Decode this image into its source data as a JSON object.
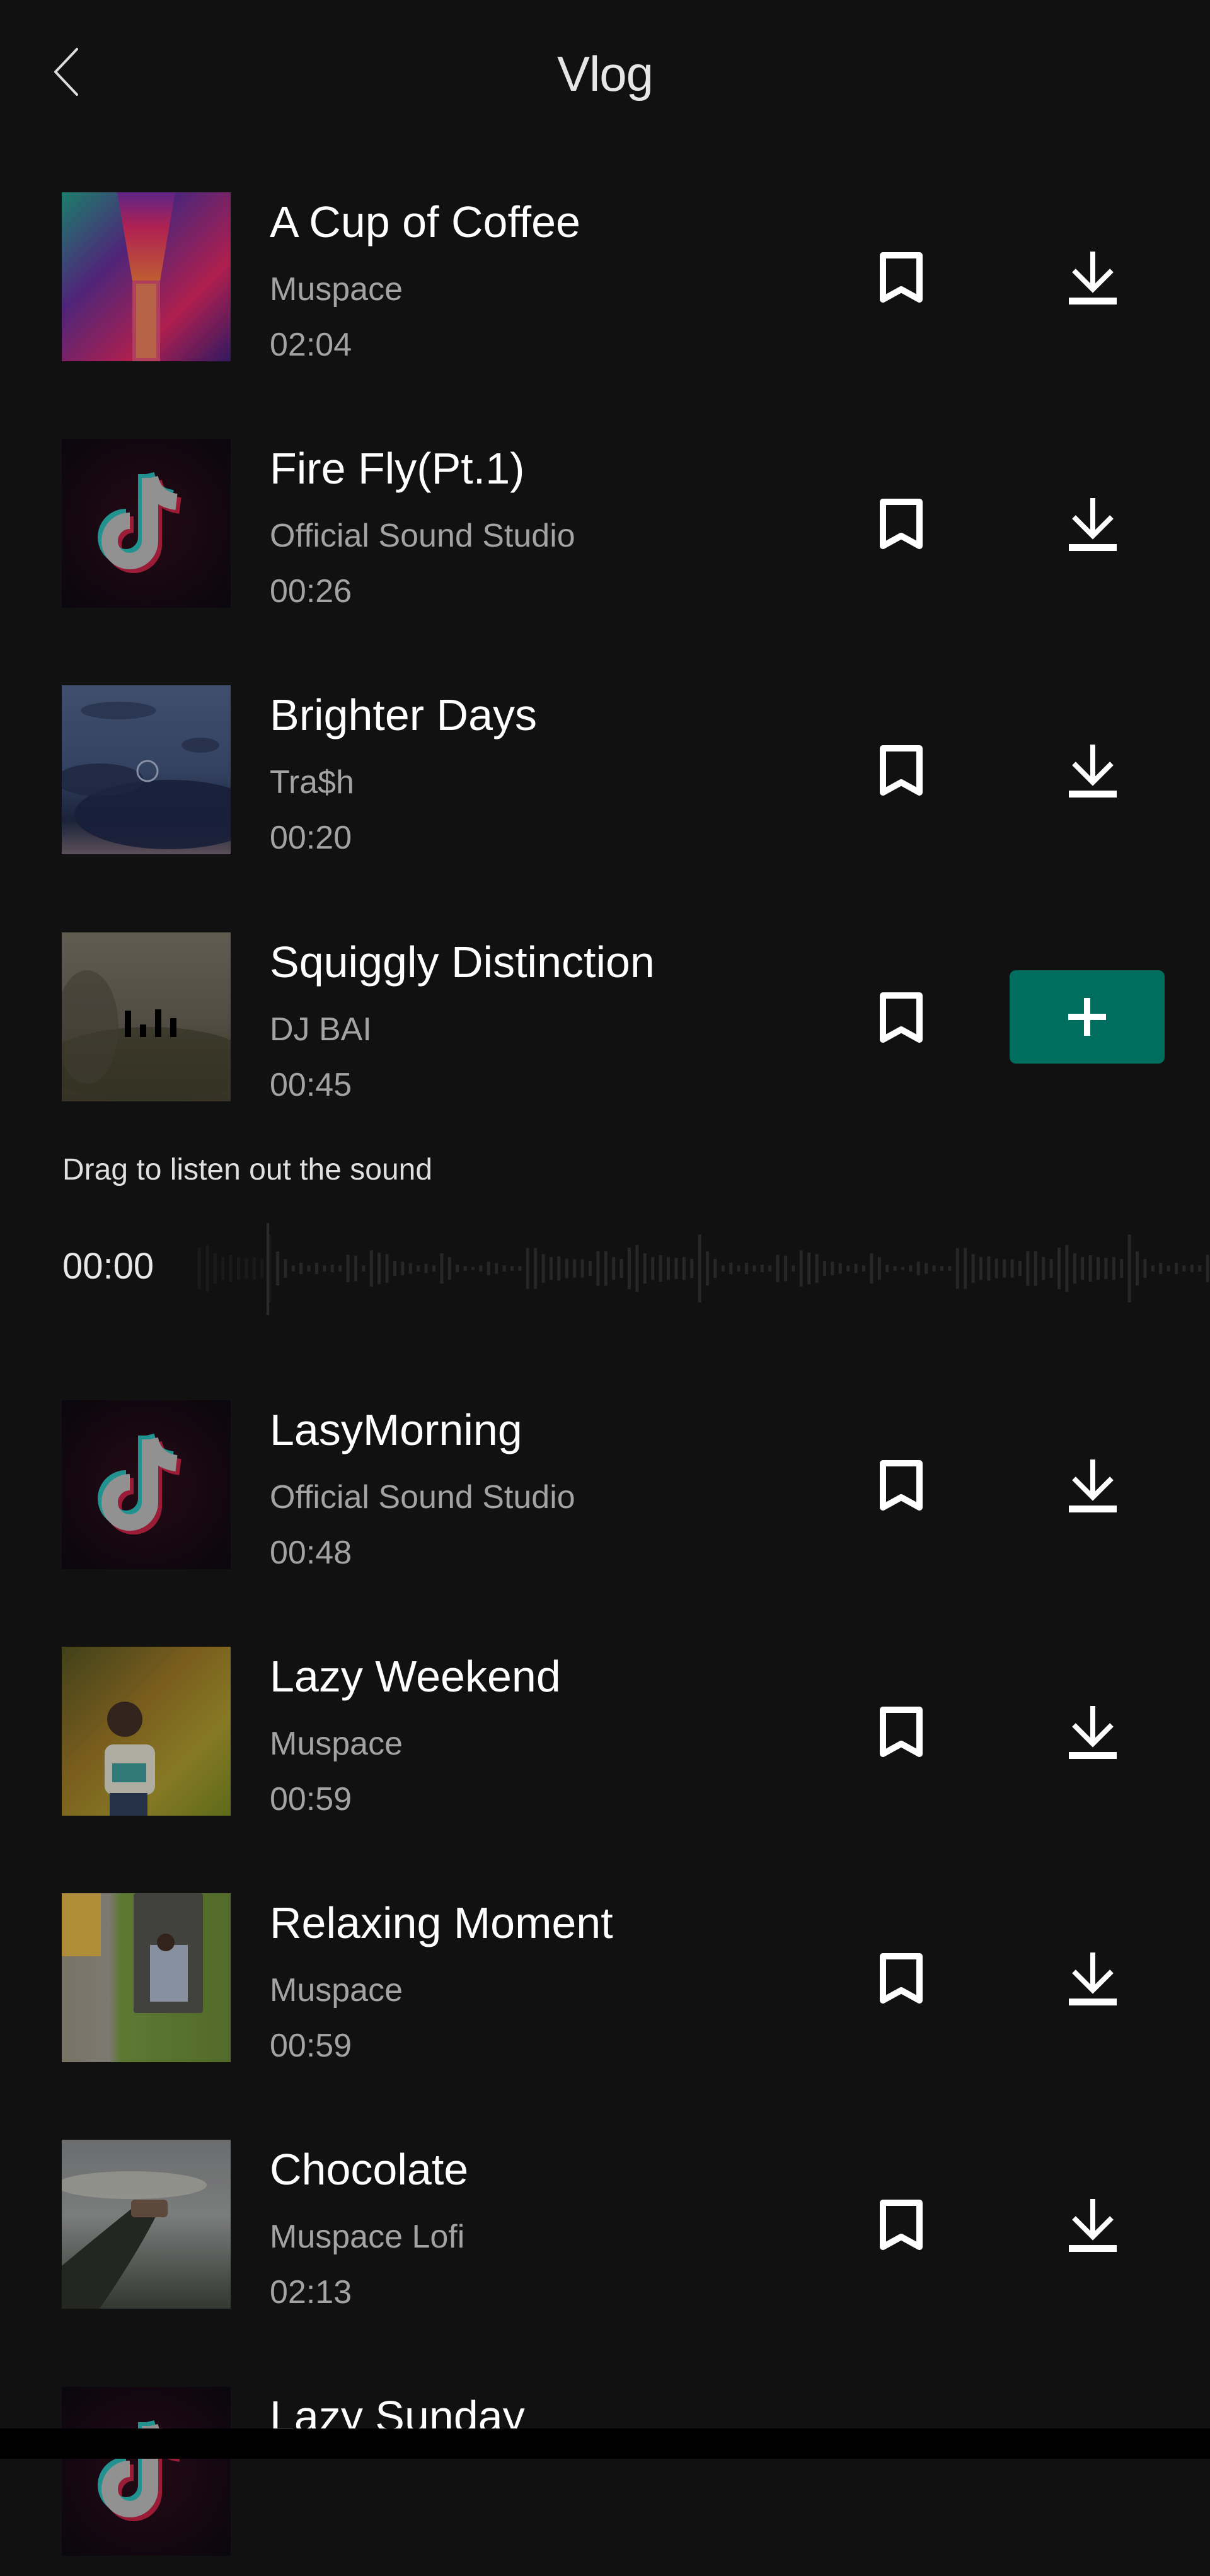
{
  "header": {
    "title": "Vlog",
    "back_icon": "chevron-left-icon"
  },
  "theme": {
    "background": "#111111",
    "accent": "#006e5f",
    "text_primary": "#ffffff",
    "text_secondary": "#a3a3a3",
    "waveform": "#272727"
  },
  "tracks": [
    {
      "title": "A Cup of Coffee",
      "artist": "Muspace",
      "duration": "02:04",
      "thumb": "neon-corridor",
      "action": "download"
    },
    {
      "title": "Fire Fly(Pt.1)",
      "artist": "Official Sound Studio",
      "duration": "00:26",
      "thumb": "tiktok-logo",
      "action": "download"
    },
    {
      "title": "Brighter Days",
      "artist": "Tra$h",
      "duration": "00:20",
      "thumb": "cloudy-sky",
      "action": "download"
    },
    {
      "title": "Squiggly Distinction",
      "artist": "DJ BAI",
      "duration": "00:45",
      "thumb": "misty-field",
      "action": "add",
      "playing": true
    },
    {
      "title": "LasyMorning",
      "artist": "Official Sound Studio",
      "duration": "00:48",
      "thumb": "tiktok-logo",
      "action": "download"
    },
    {
      "title": "Lazy Weekend",
      "artist": "Muspace",
      "duration": "00:59",
      "thumb": "child-sprinkler",
      "action": "download"
    },
    {
      "title": "Relaxing Moment",
      "artist": "Muspace",
      "duration": "00:59",
      "thumb": "mirror-selfie",
      "action": "download"
    },
    {
      "title": "Chocolate",
      "artist": "Muspace Lofi",
      "duration": "02:13",
      "thumb": "hand-cup",
      "action": "download"
    },
    {
      "title": "Lazy Sunday",
      "artist": "",
      "duration": "",
      "thumb": "tiktok-logo",
      "action": "download",
      "partially_visible": true
    }
  ],
  "player": {
    "hint": "Drag to listen out the sound",
    "current_time": "00:00",
    "progress": 0
  },
  "icons": {
    "bookmark": "bookmark-icon",
    "download": "download-icon",
    "add": "plus-icon",
    "playing": "equalizer-icon"
  }
}
